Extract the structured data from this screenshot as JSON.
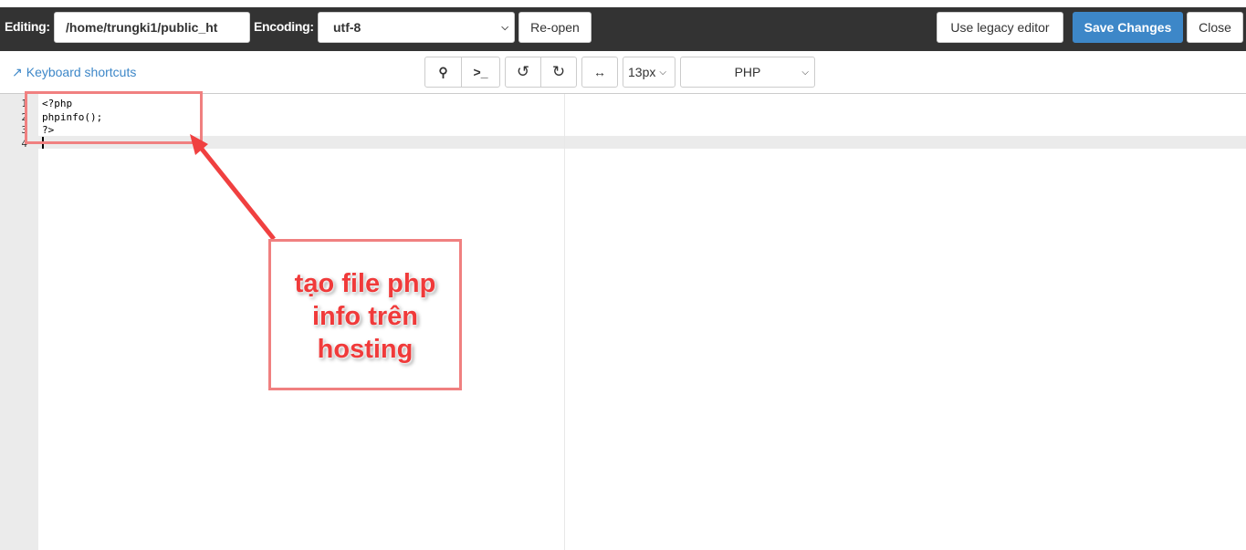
{
  "topbar": {
    "editing_label": "Editing:",
    "path": "/home/trungki1/public_ht",
    "encoding_label": "Encoding:",
    "encoding": "utf-8",
    "reopen": "Re-open",
    "legacy": "Use legacy editor",
    "save": "Save Changes",
    "close": "Close",
    "save_color": "#3d87c8"
  },
  "toolbar": {
    "shortcuts": "Keyboard shortcuts",
    "font_size": "13px",
    "mode": "PHP",
    "icons": [
      "search-icon",
      "terminal-icon",
      "undo-icon",
      "redo-icon",
      "wrap-icon"
    ]
  },
  "editor": {
    "lines": [
      {
        "n": "1",
        "text": "<?php"
      },
      {
        "n": "2",
        "text": "phpinfo();"
      },
      {
        "n": "3",
        "text": "?>"
      },
      {
        "n": "4",
        "text": ""
      }
    ]
  },
  "annotation": {
    "text": "tạo file  php info trên hosting",
    "color": "#f03a3a"
  }
}
